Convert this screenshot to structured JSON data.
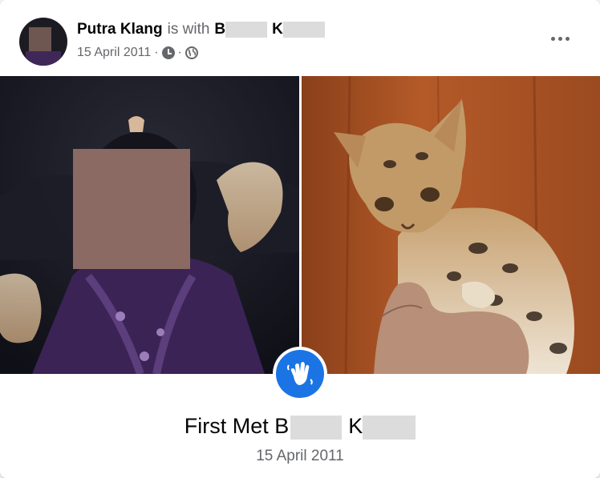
{
  "post": {
    "author": "Putra Klang",
    "with_text": "is with",
    "tagged_first_initial": "B",
    "tagged_last_initial": "K",
    "date": "15 April 2011",
    "separator": "·",
    "privacy_icon": "globe-icon",
    "time_icon": "clock-icon",
    "more_icon": "more-horizontal-icon"
  },
  "life_event": {
    "icon": "waving-hand-icon",
    "title_prefix": "First Met B",
    "title_last_initial": "K",
    "date": "15 April 2011"
  },
  "colors": {
    "accent": "#1b74e4",
    "secondary_text": "#65676b",
    "primary_text": "#050505",
    "redaction": "#dcdcdc"
  }
}
